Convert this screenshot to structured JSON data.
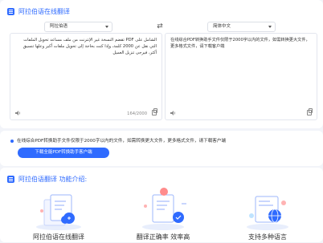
{
  "translator": {
    "title": "阿拉伯语在线翻译",
    "source_lang": "阿拉伯语",
    "target_lang": "简体中文",
    "source_text": "الشامل على PDF تقضم النسخة غير الإنترنت من ملف مساعد تحويل الملفات التي نقل عن 2000 كلمة، وإذا كنت بحاجة إلى تحويل ملفات أكبر وعلها تنسيق أكثر، فيرجى تنزيل العميل",
    "target_text": "在线综合PDF转换助手文件仅限于2000字以内的文件，如需转换更大文件，更多格式文件，请下载客户端",
    "char_count": "164/2000"
  },
  "banner": {
    "text": "在线综合PDF转换助手文件仅限于2000字以内的文件，如需转换更大文件，更多格式文件，请下载客户端",
    "button": "下载全能PDF转换助手客户端"
  },
  "intro": {
    "title": "阿拉伯语翻译 功能介绍:",
    "features": [
      {
        "label": "阿拉伯语在线翻译",
        "icon": "document-cloud-icon"
      },
      {
        "label": "翻译正确率 效率高",
        "icon": "accuracy-document-icon"
      },
      {
        "label": "支持多种语言",
        "icon": "multi-language-icon"
      }
    ]
  },
  "colors": {
    "accent": "#2f6bff",
    "background": "#f2f4f9"
  }
}
